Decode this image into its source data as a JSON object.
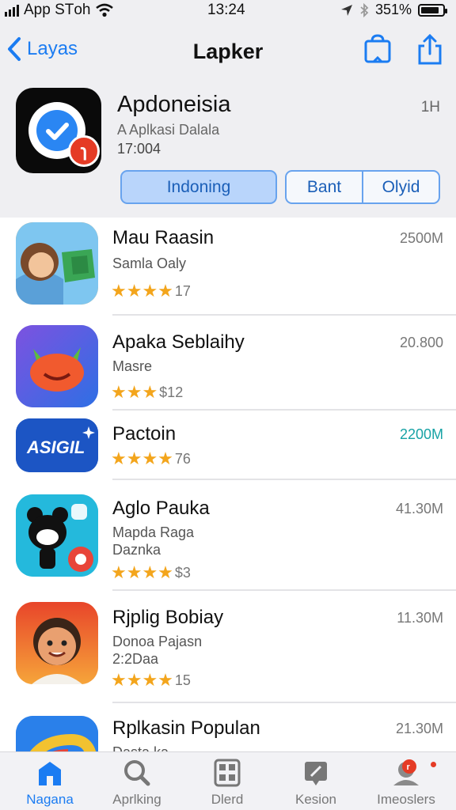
{
  "status_bar": {
    "carrier": "App STоh",
    "time": "13:24",
    "battery": "351%",
    "battery_level": 0.85
  },
  "nav": {
    "back_label": "Layas",
    "title": "Lapker"
  },
  "featured": {
    "name": "Apdoneisia",
    "meta": "1H",
    "subtitle": "A Aplkasi Dalala",
    "date": "17:004",
    "primary_button": "Indoning",
    "segment_left": "Bant",
    "segment_right": "Olyid"
  },
  "apps": [
    {
      "name": "Mau Raasin",
      "sub1": "Samla Oaly",
      "sub2": "",
      "size": "2500M",
      "stars": "★★★★",
      "count": "17"
    },
    {
      "name": "Apaka Seblaihy",
      "sub1": "Masre",
      "sub2": "",
      "size": "20.800",
      "stars": "★★★",
      "count": "$12"
    },
    {
      "name": "Pactoin",
      "sub1": "",
      "sub2": "",
      "size": "2200M",
      "stars": "★★★★",
      "count": "76",
      "icon_text": "ASIGIL"
    },
    {
      "name": "Aglo Pauka",
      "sub1": "Mapda Raga",
      "sub2": "Daznka",
      "size": "41.30M",
      "stars": "★★★★",
      "count": "$3"
    },
    {
      "name": "Rjplig Bobiay",
      "sub1": "Donoa Pajasn",
      "sub2": "2:2Daa",
      "size": "11.30M",
      "stars": "★★★★",
      "count": "15"
    },
    {
      "name": "Rplkasin Populan",
      "sub1": "Dasta ka",
      "sub2": "",
      "size": "21.30M",
      "stars": "",
      "count": ""
    }
  ],
  "tabs": [
    {
      "label": "Nagana",
      "icon": "home-icon"
    },
    {
      "label": "Aprlking",
      "icon": "search-icon"
    },
    {
      "label": "Dlerd",
      "icon": "grid-icon"
    },
    {
      "label": "Kesion",
      "icon": "edit-icon"
    },
    {
      "label": "Imeoslers",
      "icon": "profile-icon"
    }
  ],
  "colors": {
    "accent": "#1b7cf2",
    "star": "#f3a51c",
    "size_highlight": "#17a2a5",
    "badge": "#e53b25"
  }
}
